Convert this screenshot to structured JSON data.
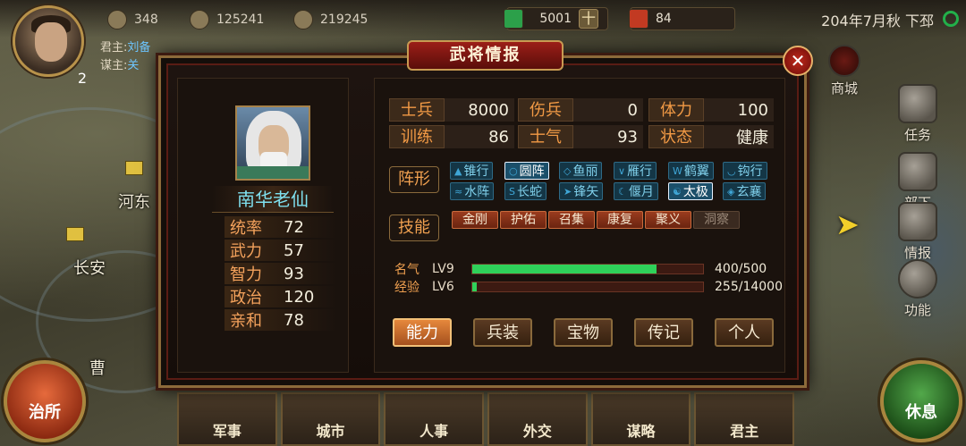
{
  "top": {
    "res1": "348",
    "res2": "125241",
    "res3": "219245",
    "res4": "5001",
    "res4_plus": "十",
    "res5": "84",
    "date": "204年7月秋",
    "location": "下邳"
  },
  "lord": {
    "level": "2",
    "lord_label": "君主:",
    "lord_name": "刘备",
    "advisor_label": "谋主:",
    "advisor_name": "关"
  },
  "map": {
    "cities": [
      "河东",
      "长安",
      "曹"
    ]
  },
  "side_menu": {
    "shop": "商城",
    "task": "任务",
    "troops": "部下",
    "intel": "情报",
    "functions": "功能"
  },
  "bottom": {
    "gov": "治所",
    "rest": "休息",
    "tabs": [
      "军事",
      "城市",
      "人事",
      "外交",
      "谋略",
      "君主"
    ]
  },
  "dialog": {
    "title": "武将情报",
    "close": "✕",
    "general": {
      "name": "南华老仙",
      "stats": [
        {
          "label": "统率",
          "value": "72"
        },
        {
          "label": "武力",
          "value": "57"
        },
        {
          "label": "智力",
          "value": "93"
        },
        {
          "label": "政治",
          "value": "120"
        },
        {
          "label": "亲和",
          "value": "78"
        }
      ]
    },
    "attrs": {
      "soldiers_k": "士兵",
      "soldiers_v": "8000",
      "wounded_k": "伤兵",
      "wounded_v": "0",
      "stamina_k": "体力",
      "stamina_v": "100",
      "training_k": "训练",
      "training_v": "86",
      "morale_k": "士气",
      "morale_v": "93",
      "status_k": "状态",
      "status_v": "健康"
    },
    "formation_label": "阵形",
    "formations": [
      {
        "name": "锥行",
        "active": false
      },
      {
        "name": "圆阵",
        "active": true
      },
      {
        "name": "鱼丽",
        "active": false
      },
      {
        "name": "雁行",
        "active": false
      },
      {
        "name": "鹤翼",
        "active": false
      },
      {
        "name": "钩行",
        "active": false
      },
      {
        "name": "水阵",
        "active": false
      },
      {
        "name": "长蛇",
        "active": false
      },
      {
        "name": "锋矢",
        "active": false
      },
      {
        "name": "偃月",
        "active": false
      },
      {
        "name": "太极",
        "active": true
      },
      {
        "name": "玄襄",
        "active": false
      }
    ],
    "skill_label": "技能",
    "skills": [
      {
        "name": "金刚",
        "dim": false
      },
      {
        "name": "护佑",
        "dim": false
      },
      {
        "name": "召集",
        "dim": false
      },
      {
        "name": "康复",
        "dim": false
      },
      {
        "name": "聚义",
        "dim": false
      },
      {
        "name": "洞察",
        "dim": true
      }
    ],
    "fame": {
      "label": "名气",
      "level": "LV9",
      "text": "400/500",
      "fraction": 0.8,
      "color": "#2fd15a"
    },
    "exp": {
      "label": "经验",
      "level": "LV6",
      "text": "255/14000",
      "fraction": 0.018,
      "color": "#2fd15a"
    },
    "buttons": [
      "能力",
      "兵装",
      "宝物",
      "传记",
      "个人"
    ]
  }
}
